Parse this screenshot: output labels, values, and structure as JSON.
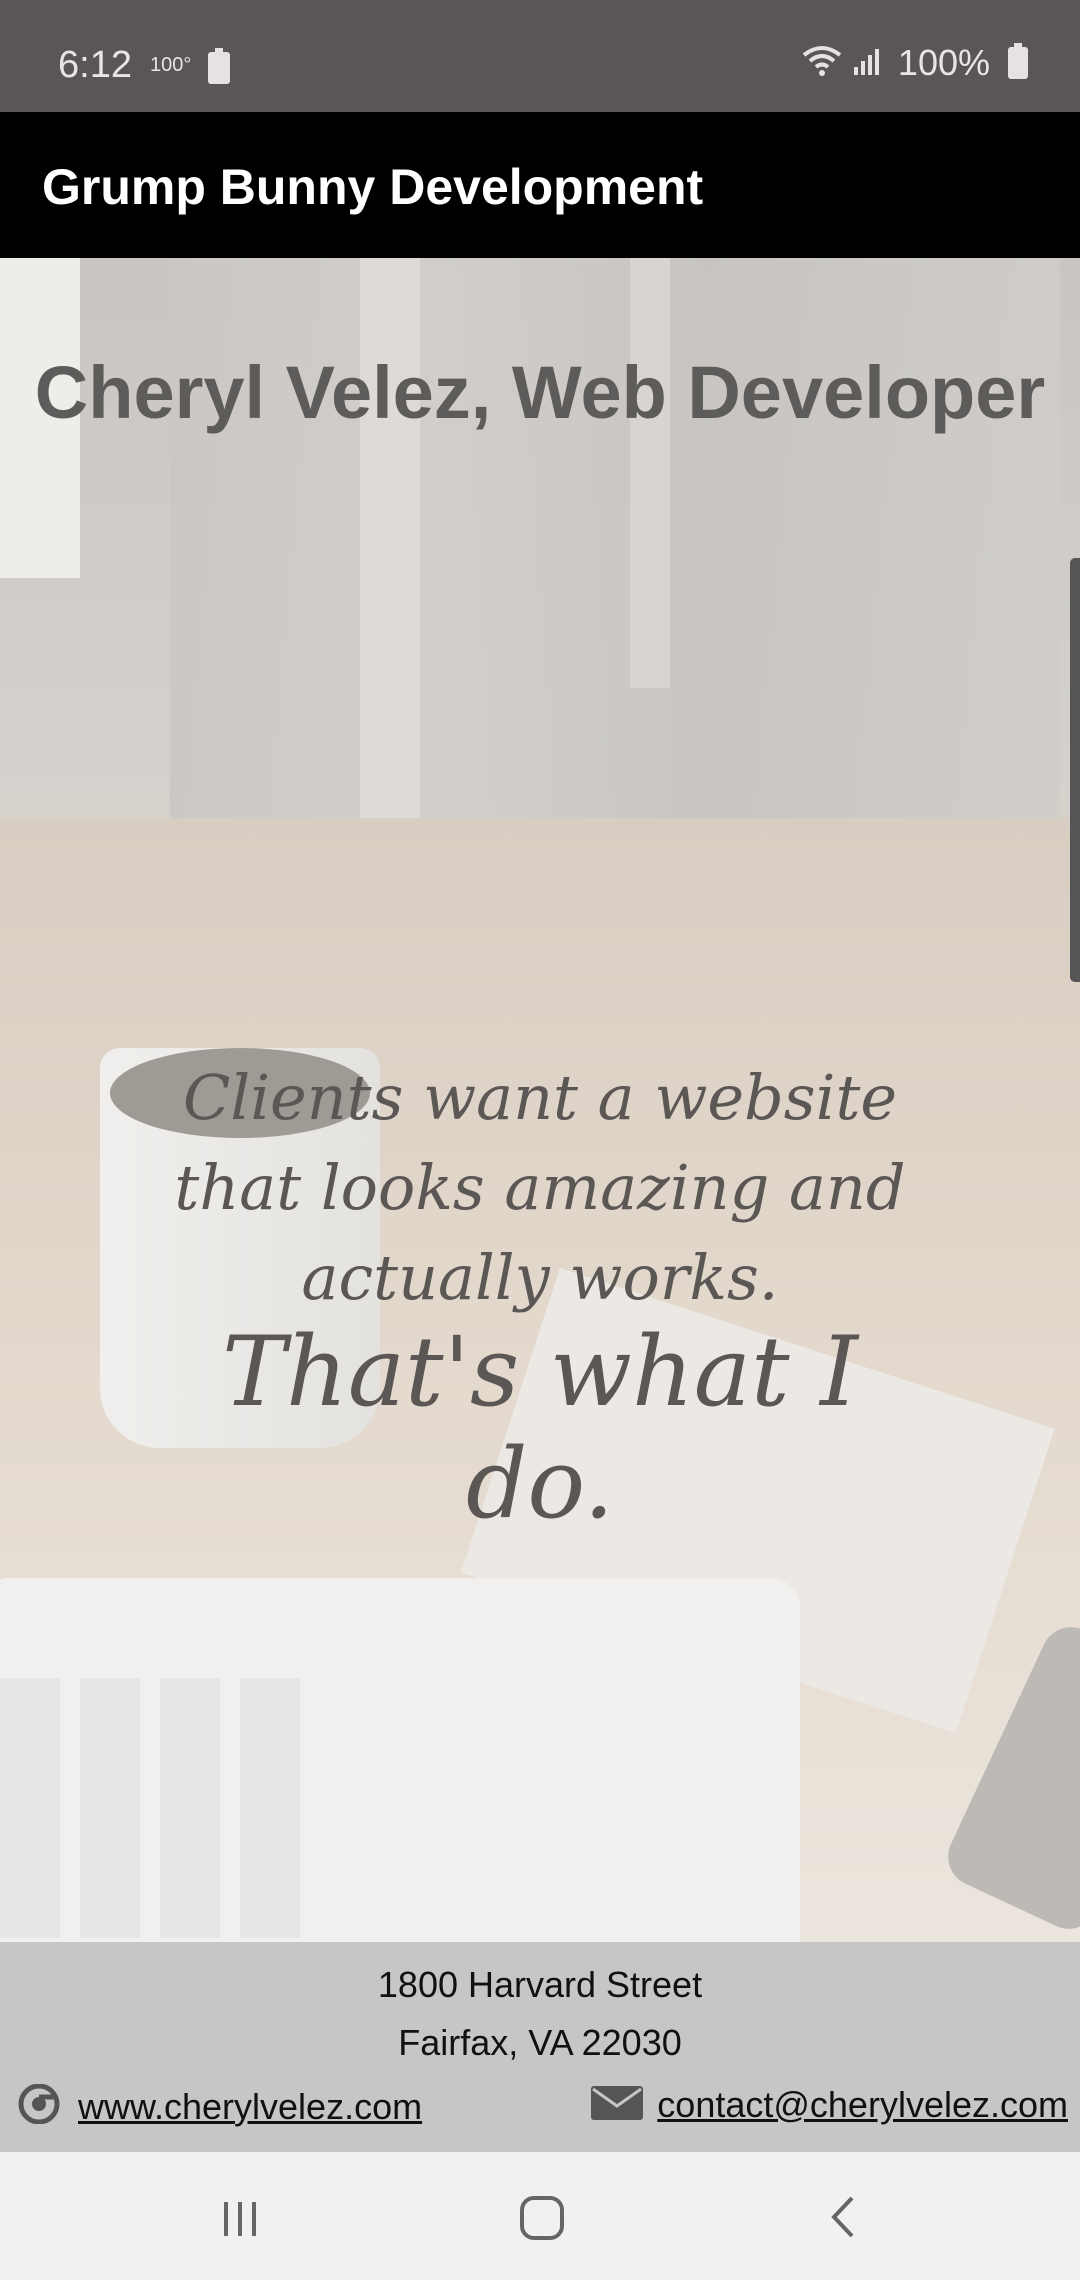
{
  "status_bar": {
    "time": "6:12",
    "temperature": "100°",
    "battery_percent": "100%",
    "icons": [
      "battery-saver-icon",
      "wifi-icon",
      "signal-icon",
      "battery-icon"
    ]
  },
  "app_bar": {
    "title": "Grump Bunny Development"
  },
  "hero": {
    "title": "Cheryl Velez, Web Developer",
    "tagline_lines": [
      "Clients want a website",
      "that looks amazing and",
      "actually works."
    ],
    "tagline_emphasis": "That's what I do."
  },
  "footer": {
    "address_line1": "1800 Harvard Street",
    "address_line2": "Fairfax, VA 22030",
    "website": "www.cherylvelez.com",
    "email": "contact@cherylvelez.com",
    "icons": [
      "chrome-icon",
      "envelope-icon"
    ]
  },
  "nav": {
    "icons": [
      "recents-icon",
      "home-icon",
      "back-icon"
    ]
  }
}
